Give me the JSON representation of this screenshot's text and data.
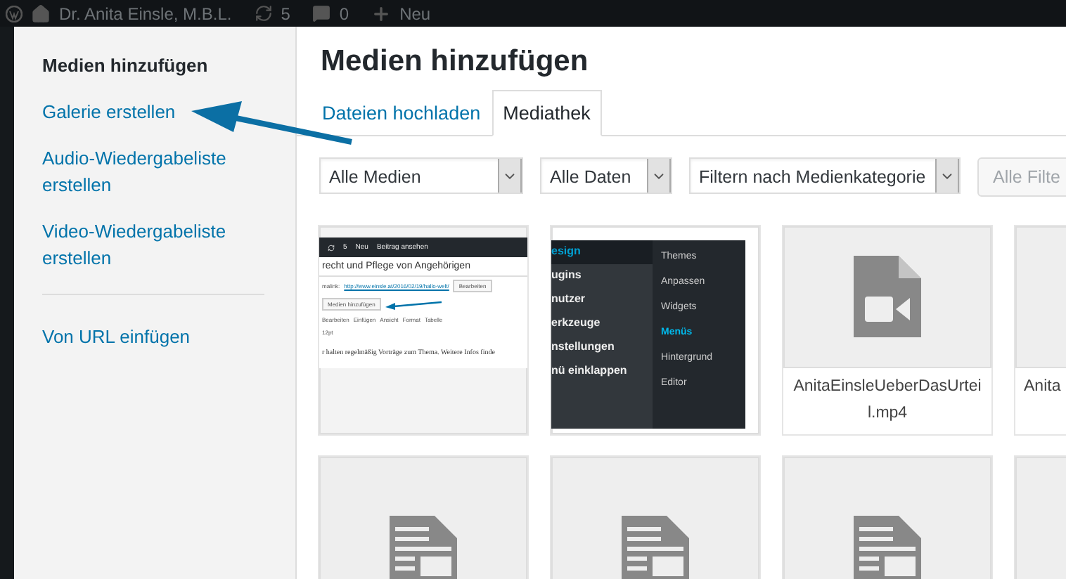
{
  "admin_bar": {
    "site": "Dr. Anita Einsle, M.B.L.",
    "updates": "5",
    "comments": "0",
    "new": "Neu"
  },
  "menu": {
    "groups": [
      [
        {
          "label": "Medien hinzufügen",
          "selected": true
        },
        {
          "label": "Galerie erstellen",
          "selected": false
        },
        {
          "label": "Audio-Wiedergabeliste erstellen",
          "selected": false
        },
        {
          "label": "Video-Wiedergabeliste erstellen",
          "selected": false
        }
      ],
      [
        {
          "label": "Von URL einfügen",
          "selected": false
        }
      ]
    ]
  },
  "title": "Medien hinzufügen",
  "tabs": [
    {
      "label": "Dateien hochladen",
      "selected": false
    },
    {
      "label": "Mediathek",
      "selected": true
    }
  ],
  "filters": [
    {
      "value": "Alle Medien"
    },
    {
      "value": "Alle Daten"
    },
    {
      "value": "Filtern nach Medienkategorie"
    }
  ],
  "filter_button": {
    "label": "Alle Filte",
    "disabled": true
  },
  "media": [
    {
      "kind": "editor_screenshot",
      "bar": [
        "5",
        "Neu",
        "Beitrag ansehen"
      ],
      "heading": "recht und Pflege von Angehörigen",
      "permalink_label": "malink:",
      "permalink": "http://www.einsle.at/2016/02/19/hallo-welt/",
      "edit": "Bearbeiten",
      "add_media": "Medien hinzufügen",
      "menus": [
        "Bearbeiten",
        "Einfügen",
        "Ansicht",
        "Format",
        "Tabelle"
      ],
      "size": "12pt",
      "body": "r halten regelmäßig Vorträge zum Thema. Weitere Infos finde"
    },
    {
      "kind": "menu_screenshot",
      "items": [
        {
          "label": "esign",
          "selected": true
        },
        {
          "label": "ugins",
          "selected": false
        },
        {
          "label": "nutzer",
          "selected": false
        },
        {
          "label": "erkzeuge",
          "selected": false
        },
        {
          "label": "nstellungen",
          "selected": false
        },
        {
          "label": "nü einklappen",
          "selected": false
        }
      ],
      "submenu": [
        {
          "label": "Themes",
          "selected": false
        },
        {
          "label": "Anpassen",
          "selected": false
        },
        {
          "label": "Widgets",
          "selected": false
        },
        {
          "label": "Menüs",
          "selected": true
        },
        {
          "label": "Hintergrund",
          "selected": false
        },
        {
          "label": "Editor",
          "selected": false
        }
      ]
    },
    {
      "kind": "video",
      "filename": "AnitaEinsleUeberDasUrteil.mp4"
    },
    {
      "kind": "video_cut",
      "filename": "Anita"
    },
    {
      "kind": "document"
    },
    {
      "kind": "document"
    },
    {
      "kind": "document"
    },
    {
      "kind": "cut"
    }
  ]
}
